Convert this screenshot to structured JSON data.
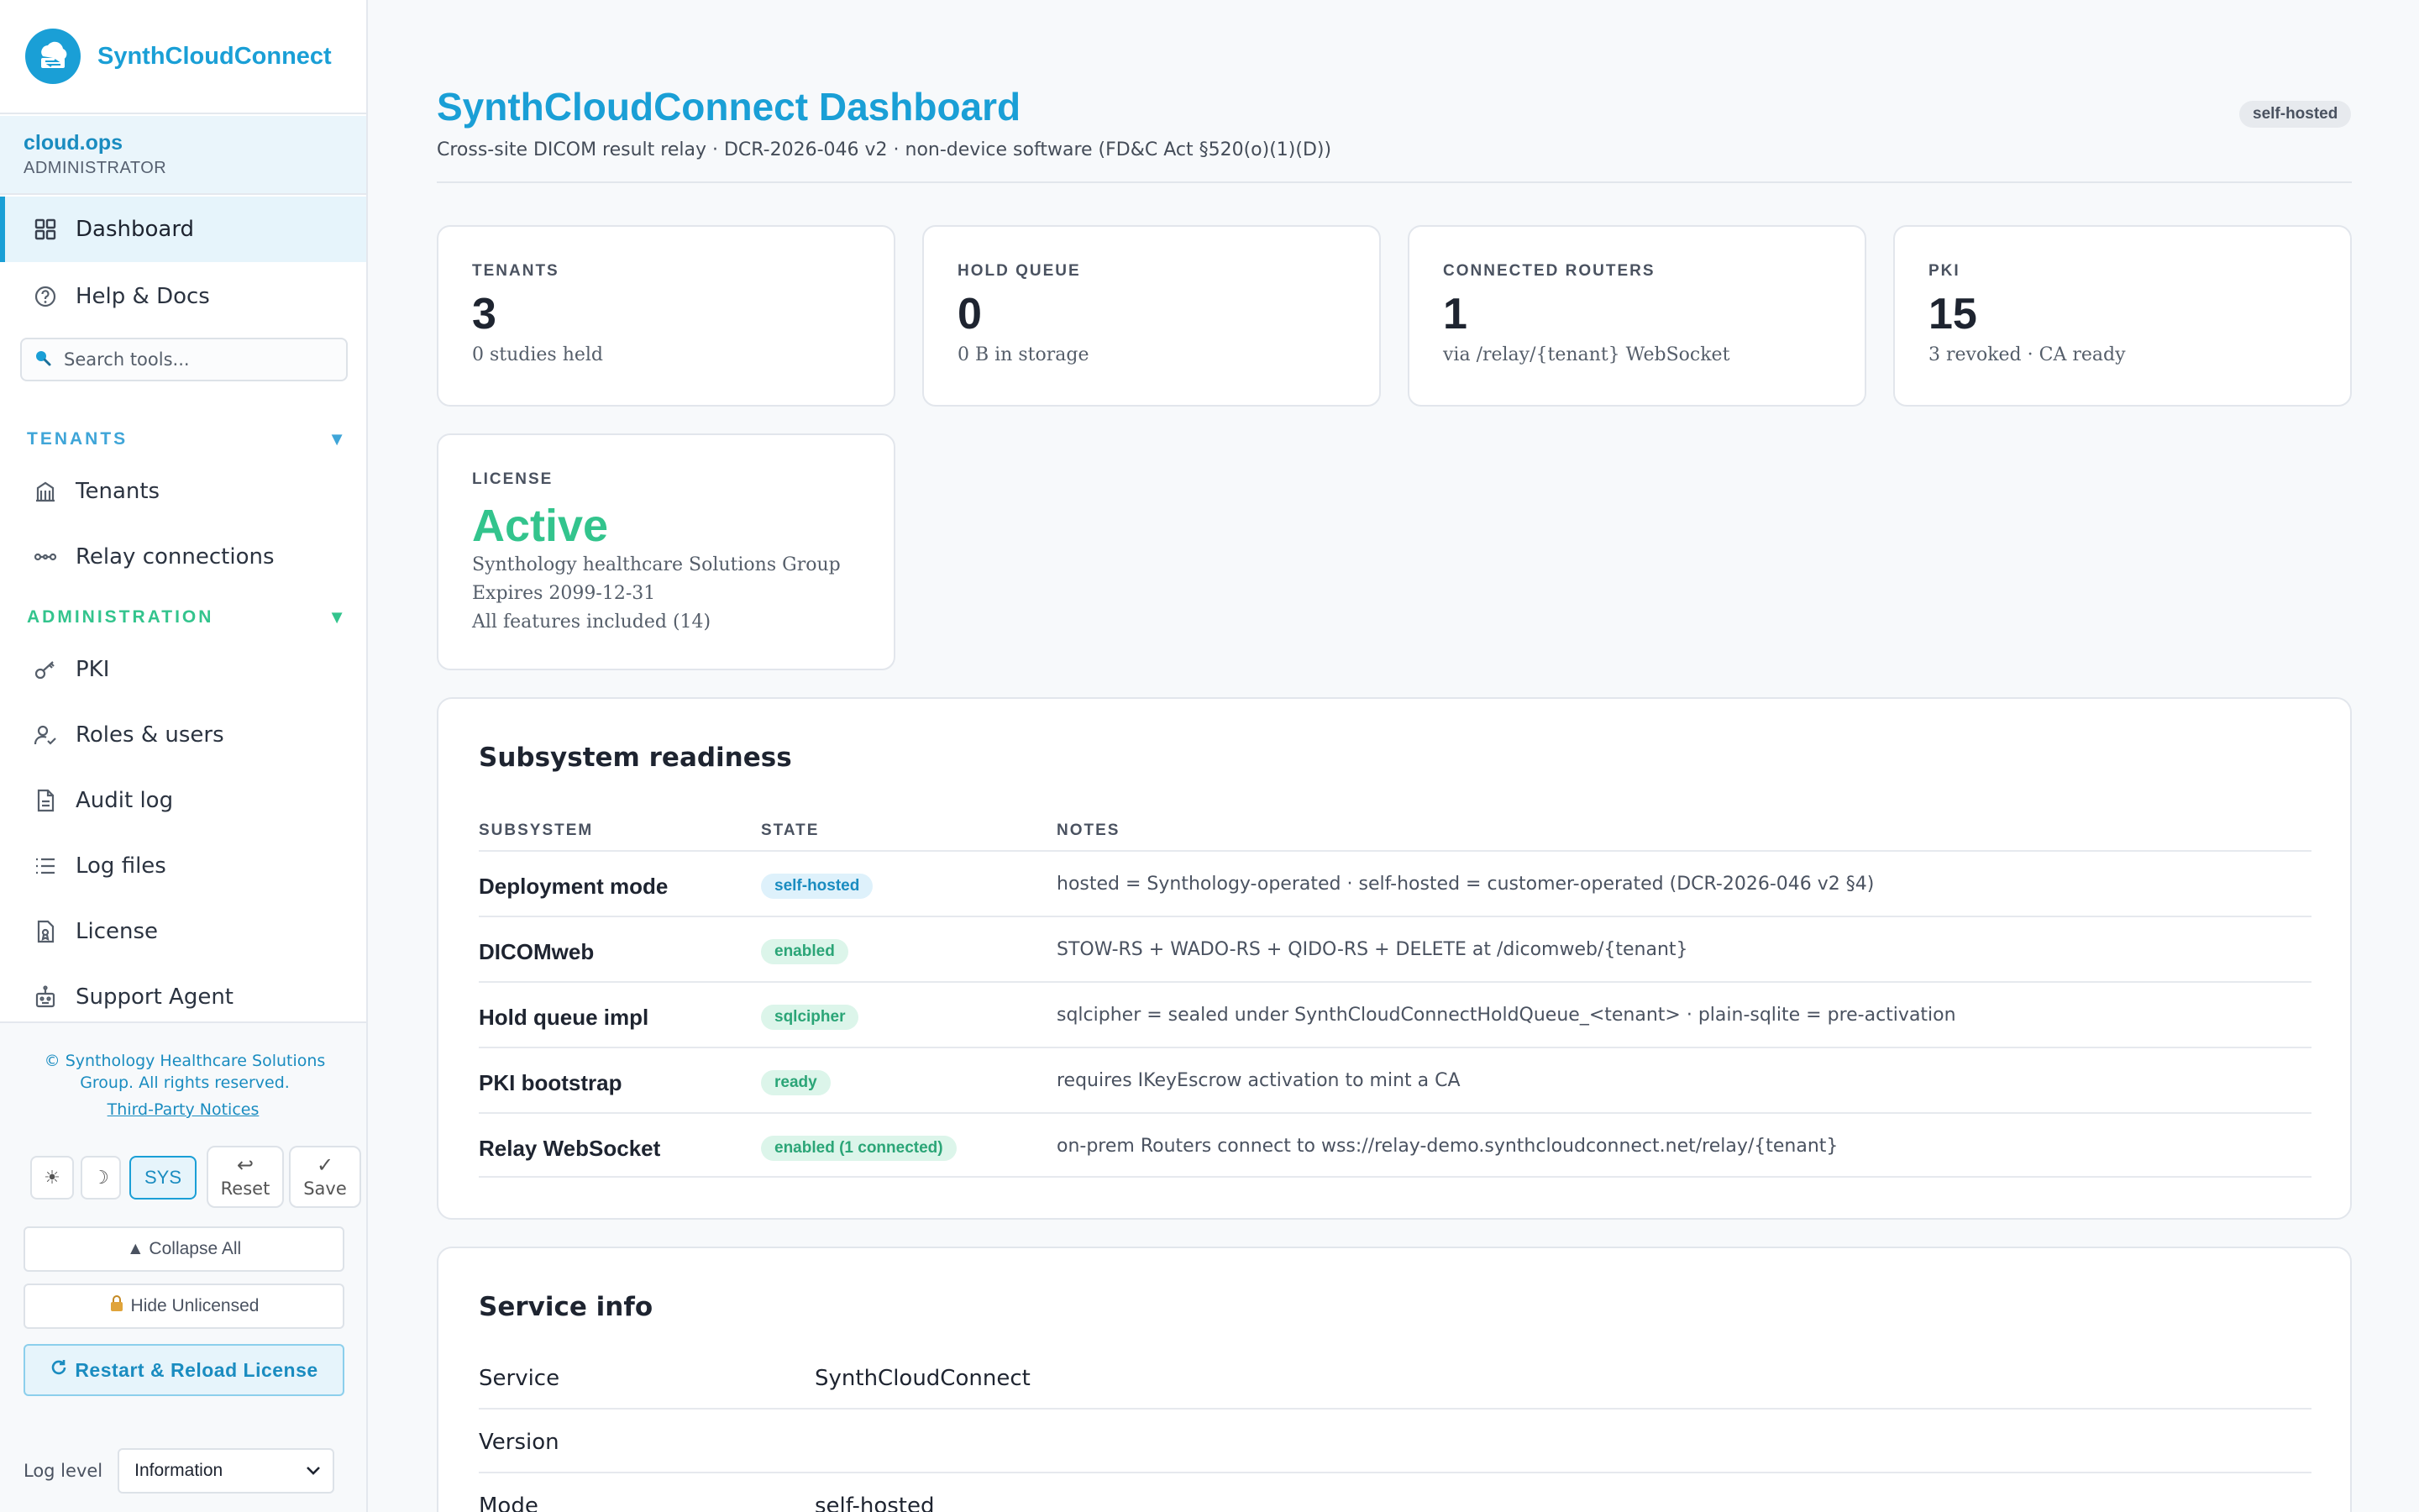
{
  "brand": {
    "name": "SynthCloudConnect",
    "logo_icon": "cloud-relay-logo-icon"
  },
  "user": {
    "name": "cloud.ops",
    "role": "ADMINISTRATOR"
  },
  "nav_top": [
    {
      "label": "Dashboard",
      "icon": "grid-icon",
      "active": true
    },
    {
      "label": "Help & Docs",
      "icon": "help-circle-icon"
    }
  ],
  "search": {
    "placeholder": "Search tools..."
  },
  "sections": [
    {
      "title": "TENANTS",
      "color": "#3fa5d8",
      "items": [
        {
          "label": "Tenants",
          "icon": "building-icon"
        },
        {
          "label": "Relay connections",
          "icon": "link-icon"
        }
      ]
    },
    {
      "title": "ADMINISTRATION",
      "color": "#33c48d",
      "items": [
        {
          "label": "PKI",
          "icon": "key-icon"
        },
        {
          "label": "Roles & users",
          "icon": "user-check-icon"
        },
        {
          "label": "Audit log",
          "icon": "file-text-icon"
        },
        {
          "label": "Log files",
          "icon": "list-icon"
        },
        {
          "label": "License",
          "icon": "license-icon"
        },
        {
          "label": "Support Agent",
          "icon": "robot-icon"
        }
      ]
    }
  ],
  "footer": {
    "copyright": "© Synthology Healthcare Solutions Group. All rights reserved.",
    "notices": "Third-Party Notices",
    "theme": {
      "light": "☀",
      "dark": "☽",
      "system": "SYS"
    },
    "reset": {
      "glyph": "↩",
      "label": "Reset"
    },
    "save": {
      "glyph": "✓",
      "label": "Save"
    },
    "collapse_all": "▲ Collapse All",
    "hide_unlicensed": "Hide Unlicensed",
    "restart": "Restart & Reload License",
    "log_level_label": "Log level",
    "log_level_value": "Information"
  },
  "header": {
    "title": "SynthCloudConnect Dashboard",
    "subtitle": "Cross-site DICOM result relay · DCR-2026-046 v2 · non-device software (FD&C Act §520(o)(1)(D))",
    "mode_badge": "self-hosted"
  },
  "stats": [
    {
      "label": "TENANTS",
      "value": "3",
      "note": "0 studies held"
    },
    {
      "label": "HOLD QUEUE",
      "value": "0",
      "note": "0 B in storage"
    },
    {
      "label": "CONNECTED ROUTERS",
      "value": "1",
      "note": "via /relay/{tenant} WebSocket"
    },
    {
      "label": "PKI",
      "value": "15",
      "note": "3 revoked · CA ready"
    }
  ],
  "license": {
    "label": "LICENSE",
    "value": "Active",
    "holder": "Synthology healthcare Solutions Group",
    "expires": "Expires 2099-12-31",
    "features": "All features included (14)"
  },
  "readiness": {
    "title": "Subsystem readiness",
    "columns": [
      "SUBSYSTEM",
      "STATE",
      "NOTES"
    ],
    "rows": [
      {
        "name": "Deployment mode",
        "state": "self-hosted",
        "tone": "blue",
        "notes": "hosted = Synthology-operated · self-hosted = customer-operated (DCR-2026-046 v2 §4)"
      },
      {
        "name": "DICOMweb",
        "state": "enabled",
        "tone": "green",
        "notes": "STOW-RS + WADO-RS + QIDO-RS + DELETE at /dicomweb/{tenant}"
      },
      {
        "name": "Hold queue impl",
        "state": "sqlcipher",
        "tone": "green",
        "notes": "sqlcipher = sealed under SynthCloudConnectHoldQueue_<tenant> · plain-sqlite = pre-activation"
      },
      {
        "name": "PKI bootstrap",
        "state": "ready",
        "tone": "green",
        "notes": "requires IKeyEscrow activation to mint a CA"
      },
      {
        "name": "Relay WebSocket",
        "state": "enabled (1 connected)",
        "tone": "green",
        "notes": "on-prem Routers connect to wss://relay-demo.synthcloudconnect.net/relay/{tenant}"
      }
    ]
  },
  "service_info": {
    "title": "Service info",
    "rows": [
      {
        "key": "Service",
        "value": "SynthCloudConnect"
      },
      {
        "key": "Version",
        "value": ""
      },
      {
        "key": "Mode",
        "value": "self-hosted"
      }
    ]
  },
  "colors": {
    "accent": "#1a9fd6",
    "success": "#33c48d",
    "admin_section": "#33c48d",
    "tenants_section": "#3fa5d8"
  }
}
